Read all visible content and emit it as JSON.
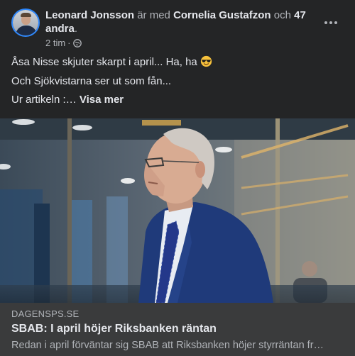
{
  "header": {
    "author": "Leonard Jonsson",
    "with_text": " är med ",
    "tagged": "Cornelia Gustafzon",
    "and_text": " och ",
    "others": "47 andra",
    "period": ".",
    "time": "2 tim",
    "dot": "·",
    "privacy_icon": "globe-icon",
    "more_icon": "more-options-icon"
  },
  "post": {
    "line1": "Åsa Nisse skjuter skarpt i april... Ha, ha",
    "line1_emoji": "sunglasses-emoji",
    "line2": "Och Sjökvistarna ser ut som fån...",
    "line3": "Ur artikeln :…",
    "see_more": "Visa mer"
  },
  "link_preview": {
    "domain": "DAGENSPS.SE",
    "title": "SBAB: I april höjer Riksbanken räntan",
    "description": "Redan i april förväntar sig SBAB att Riksbanken höjer styrräntan fr…"
  },
  "colors": {
    "background": "#242526",
    "link_bg": "#3a3b3c",
    "text": "#e4e6eb",
    "muted": "#b0b3b8",
    "avatar_ring": "#2d88ff"
  }
}
